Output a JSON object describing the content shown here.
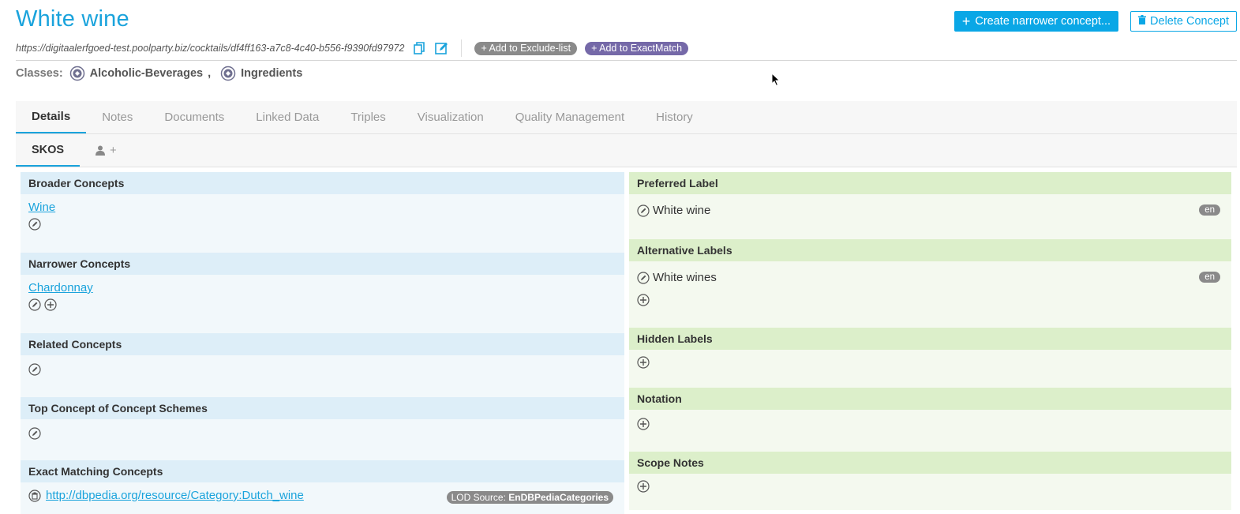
{
  "header": {
    "title": "White wine",
    "create_narrower_label": "Create narrower concept...",
    "delete_label": "Delete Concept",
    "uri": "https://digitaalerfgoed-test.poolparty.biz/cocktails/df4ff163-a7c8-4c40-b556-f9390fd97972",
    "add_exclude_label": "+ Add to Exclude-list",
    "add_exactmatch_label": "+ Add to ExactMatch"
  },
  "classes": {
    "label": "Classes:",
    "items": [
      "Alcoholic-Beverages",
      "Ingredients"
    ],
    "separator": ","
  },
  "tabs": [
    "Details",
    "Notes",
    "Documents",
    "Linked Data",
    "Triples",
    "Visualization",
    "Quality Management",
    "History"
  ],
  "subtabs": {
    "skos": "SKOS",
    "add_symbol": "+"
  },
  "left": {
    "broader": {
      "title": "Broader Concepts",
      "link": "Wine"
    },
    "narrower": {
      "title": "Narrower Concepts",
      "link": "Chardonnay"
    },
    "related": {
      "title": "Related Concepts"
    },
    "top_concept": {
      "title": "Top Concept of Concept Schemes"
    },
    "exact": {
      "title": "Exact Matching Concepts",
      "link": "http://dbpedia.org/resource/Category:Dutch_wine",
      "lod_prefix": "LOD Source:",
      "lod_source": "EnDBPediaCategories"
    }
  },
  "right": {
    "preferred": {
      "title": "Preferred Label",
      "value": "White wine",
      "lang": "en"
    },
    "alternative": {
      "title": "Alternative Labels",
      "value": "White wines",
      "lang": "en"
    },
    "hidden": {
      "title": "Hidden Labels"
    },
    "notation": {
      "title": "Notation"
    },
    "scope": {
      "title": "Scope Notes"
    }
  },
  "colors": {
    "accent": "#1aa3dc",
    "left_header_bg": "#ddeef8",
    "right_header_bg": "#dcefca",
    "pill_purple": "#7569a8",
    "pill_grey": "#8a8a8a"
  },
  "icons": {
    "edit": "pencil-circle-icon",
    "add": "plus-circle-icon",
    "delete": "trash-circle-icon",
    "copy": "copy-icon",
    "edit_uri": "edit-square-icon",
    "class": "class-badge-icon",
    "user": "user-icon"
  }
}
